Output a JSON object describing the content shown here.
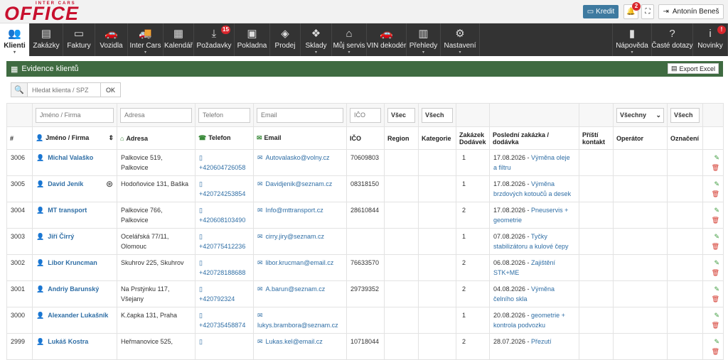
{
  "brand": {
    "tagline": "INTER CARS",
    "name": "OFFICE"
  },
  "topbar": {
    "kredit_label": "Kredit",
    "notifications_count": "2",
    "user_name": "Antonín Beneš"
  },
  "nav": [
    {
      "label": "Klienti",
      "icon": "users-icon",
      "glyph": "👥",
      "active": true,
      "caret": true
    },
    {
      "label": "Zakázky",
      "icon": "orders-icon",
      "glyph": "▤"
    },
    {
      "label": "Faktury",
      "icon": "card-icon",
      "glyph": "▭"
    },
    {
      "label": "Vozidla",
      "icon": "car-icon",
      "glyph": "🚗"
    },
    {
      "label": "Inter Cars",
      "icon": "truck-icon",
      "glyph": "🚚",
      "caret": true
    },
    {
      "label": "Kalendář",
      "icon": "calendar-icon",
      "glyph": "▦"
    },
    {
      "label": "Požadavky",
      "icon": "download-icon",
      "glyph": "⤓",
      "badge": "15"
    },
    {
      "label": "Pokladna",
      "icon": "money-icon",
      "glyph": "▣"
    },
    {
      "label": "Prodej",
      "icon": "box-icon",
      "glyph": "◈"
    },
    {
      "label": "Sklady",
      "icon": "cubes-icon",
      "glyph": "❖",
      "caret": true
    },
    {
      "label": "Můj servis",
      "icon": "home-icon",
      "glyph": "⌂",
      "caret": true
    },
    {
      "label": "VIN dekodér",
      "icon": "car-icon",
      "glyph": "🚗"
    },
    {
      "label": "Přehledy",
      "icon": "bar-chart-icon",
      "glyph": "▥",
      "caret": true
    },
    {
      "label": "Nastavení",
      "icon": "gear-icon",
      "glyph": "⚙",
      "caret": true
    }
  ],
  "nav_right": [
    {
      "label": "Nápověda",
      "icon": "book-icon",
      "glyph": "▮",
      "caret": true
    },
    {
      "label": "Časté dotazy",
      "icon": "question-icon",
      "glyph": "?"
    },
    {
      "label": "Novinky",
      "icon": "info-icon",
      "glyph": "i",
      "badge": "!"
    }
  ],
  "panel": {
    "title": "Evidence klientů",
    "export_label": "Export Excel"
  },
  "search": {
    "placeholder": "Hledat klienta / SPZ",
    "ok_label": "OK"
  },
  "filters": {
    "name_placeholder": "Jméno / Firma",
    "address_placeholder": "Adresa",
    "phone_placeholder": "Telefon",
    "email_placeholder": "Email",
    "ico_placeholder": "IČO",
    "region_value": "Všec",
    "category_value": "Všech",
    "operator_value": "Všechny",
    "tag_value": "Všech"
  },
  "columns": {
    "num": "#",
    "name": "Jméno / Firma",
    "address": "Adresa",
    "phone": "Telefon",
    "email": "Email",
    "ico": "IČO",
    "region": "Region",
    "category": "Kategorie",
    "orders": "Zakázek Dodávek",
    "last_order": "Poslední zakázka / dodávka",
    "next_contact": "Příští kontakt",
    "operator": "Operátor",
    "tag": "Označení"
  },
  "rows": [
    {
      "id": "3006",
      "name": "Michal Valaško",
      "address": "Palkovice 519, Palkovice",
      "phone": "+420604726058",
      "email": "Autovalasko@volny.cz",
      "ico": "70609803",
      "orders": "1",
      "last_date": "17.08.2026",
      "last_desc": "Výměna oleje a filtru"
    },
    {
      "id": "3005",
      "name": "David Jeník",
      "address": "Hodoňovice 131, Baška",
      "phone": "+420724253854",
      "email": "Davidjenik@seznam.cz",
      "ico": "08318150",
      "orders": "1",
      "last_date": "17.08.2026",
      "last_desc": "Výměna brzdových kotoučů a desek",
      "wheel": true
    },
    {
      "id": "3004",
      "name": "MT transport",
      "address": "Palkovice 766, Palkovice",
      "phone": "+420608103490",
      "email": "Info@mttransport.cz",
      "ico": "28610844",
      "orders": "2",
      "last_date": "17.08.2026",
      "last_desc": "Pneuservis + geometrie"
    },
    {
      "id": "3003",
      "name": "Jiří Čirrý",
      "address": "Ocelářská 77/11, Olomouc",
      "phone": "+420775412236",
      "email": "cirry.jiry@seznam.cz",
      "ico": "",
      "orders": "1",
      "last_date": "07.08.2026",
      "last_desc": "Tyčky stabilizátoru a kulové čepy"
    },
    {
      "id": "3002",
      "name": "Libor Kruncman",
      "address": "Skuhrov 225, Skuhrov",
      "phone": "+420728188688",
      "email": "libor.krucman@email.cz",
      "ico": "76633570",
      "orders": "2",
      "last_date": "06.08.2026",
      "last_desc": "Zajištění STK+ME"
    },
    {
      "id": "3001",
      "name": "Andriy Barunský",
      "address": "Na Prstýnku 117, Všejany",
      "phone": "+420792324",
      "email": "A.barun@seznam.cz",
      "ico": "29739352",
      "orders": "2",
      "last_date": "04.08.2026",
      "last_desc": "Výměna čelního skla"
    },
    {
      "id": "3000",
      "name": "Alexander Lukašník",
      "address": "K.čapka 131, Praha",
      "phone": "+420735458874",
      "email": "lukys.brambora@seznam.cz",
      "ico": "",
      "orders": "1",
      "last_date": "20.08.2026",
      "last_desc": "geometrie + kontrola podvozku"
    },
    {
      "id": "2999",
      "name": "Lukáš Kostra",
      "address": "Heřmanovice 525,",
      "phone": "",
      "email": "Lukas.kel@email.cz",
      "ico": "10718044",
      "orders": "2",
      "last_date": "28.07.2026",
      "last_desc": "Přezutí"
    }
  ]
}
